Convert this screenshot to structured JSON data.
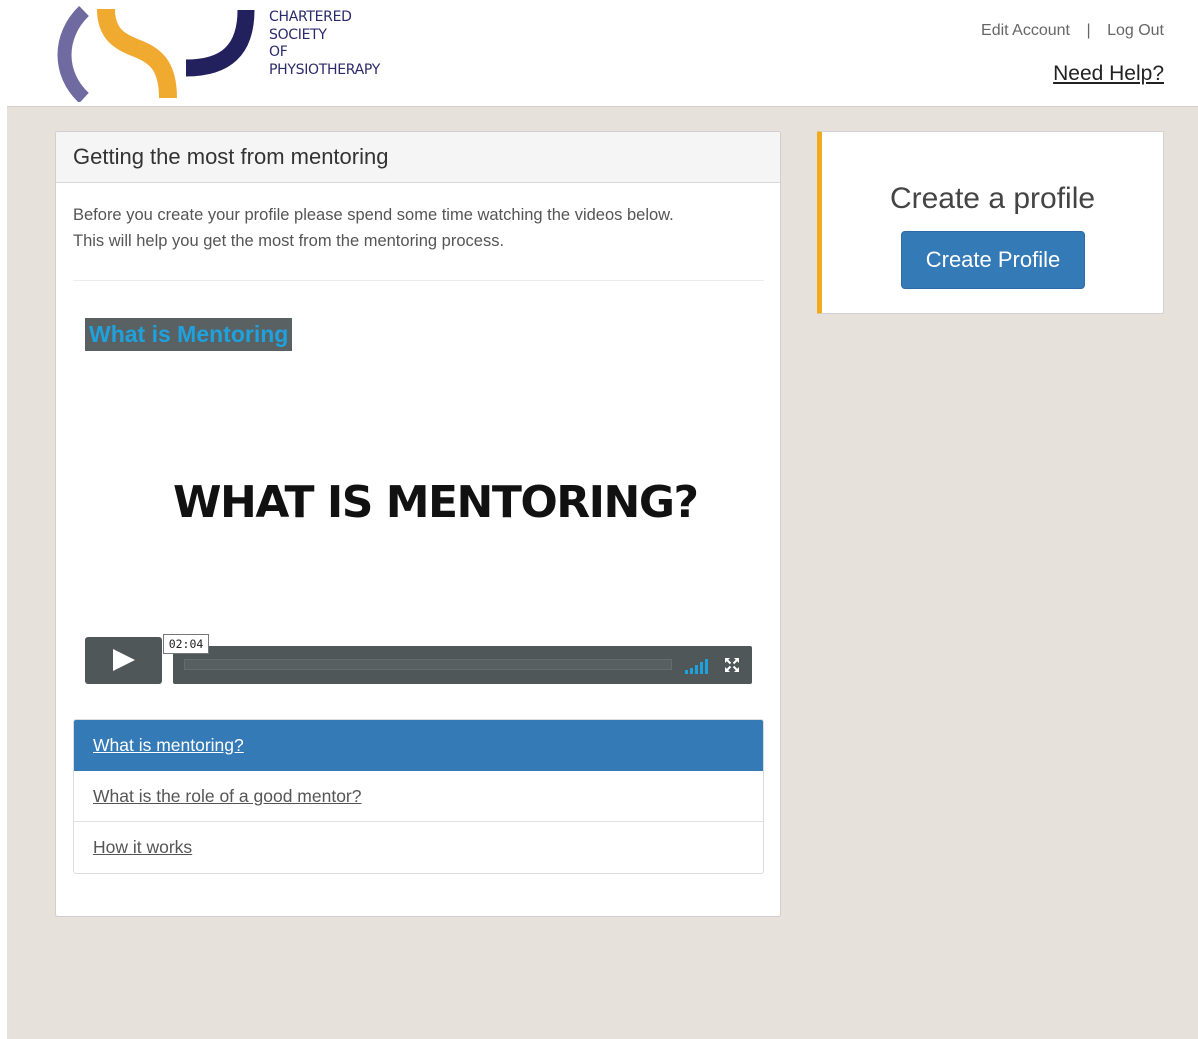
{
  "header": {
    "logo_lines": [
      "CHARTERED",
      "SOCIETY",
      "OF",
      "PHYSIOTHERAPY"
    ],
    "edit_account": "Edit Account",
    "separator": "|",
    "log_out": "Log Out",
    "need_help": "Need Help?",
    "logo_colors": {
      "purple": "#6f6aa0",
      "orange": "#f0aa30",
      "navy": "#23205e"
    }
  },
  "main_panel": {
    "heading": "Getting the most from mentoring",
    "intro_line1": "Before you create your profile please spend some time watching the videos below.",
    "intro_line2": "This will help you get the most from the mentoring process.",
    "video": {
      "title": "What is Mentoring",
      "frame_text": "WHAT IS MENTORING?",
      "time": "02:04",
      "play_icon": "play-icon",
      "volume_icon": "volume-icon",
      "fullscreen_icon": "fullscreen-icon"
    },
    "video_list": [
      {
        "label": "What is mentoring?",
        "active": true
      },
      {
        "label": "What is the role of a good mentor?",
        "active": false
      },
      {
        "label": "How it works",
        "active": false
      }
    ]
  },
  "side_card": {
    "title": "Create a profile",
    "button_label": "Create Profile",
    "accent_color": "#f0aa1e",
    "button_color": "#337ab7"
  }
}
